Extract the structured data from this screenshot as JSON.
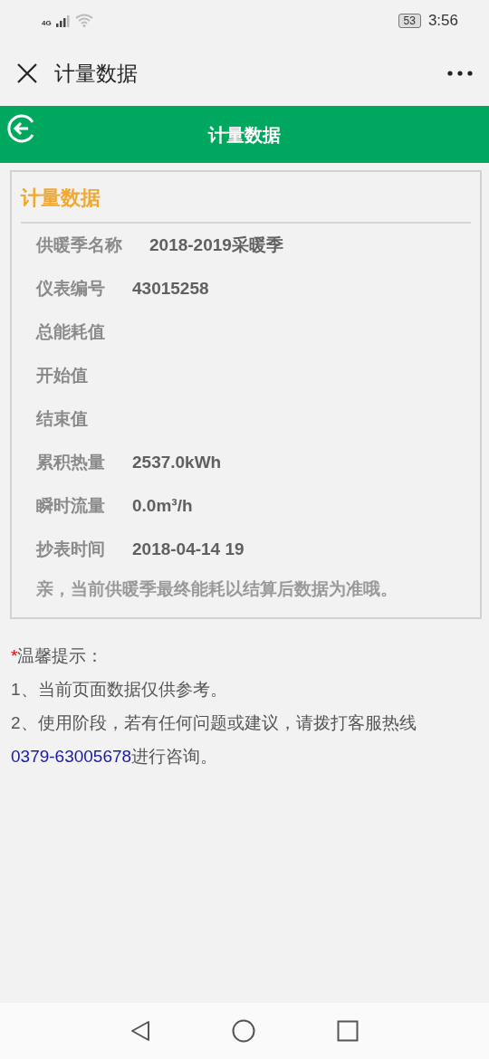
{
  "status_bar": {
    "network": "4G",
    "battery": "53",
    "time": "3:56"
  },
  "title_bar": {
    "title": "计量数据"
  },
  "header": {
    "title": "计量数据"
  },
  "card": {
    "title": "计量数据",
    "rows": [
      {
        "label": "供暖季名称",
        "value": "2018-2019采暖季"
      },
      {
        "label": "仪表编号",
        "value": "43015258"
      },
      {
        "label": "总能耗值"
      },
      {
        "label": "开始值"
      },
      {
        "label": "结束值"
      },
      {
        "label": "累积热量",
        "value": "2537.0kWh"
      },
      {
        "label": "瞬时流量",
        "value": "0.0m³/h"
      },
      {
        "label": "抄表时间",
        "value": "2018-04-14 19"
      }
    ],
    "note": "亲，当前供暖季最终能耗以结算后数据为准哦。"
  },
  "tips": {
    "mark": "*",
    "title": "温馨提示：",
    "items": [
      {
        "text": "1、当前页面数据仅供参考。"
      },
      {
        "text": "2、使用阶段，若有任何问题或建议，请拨打客服热线",
        "phone": "0379-63005678",
        "after": "进行咨询。"
      }
    ]
  }
}
